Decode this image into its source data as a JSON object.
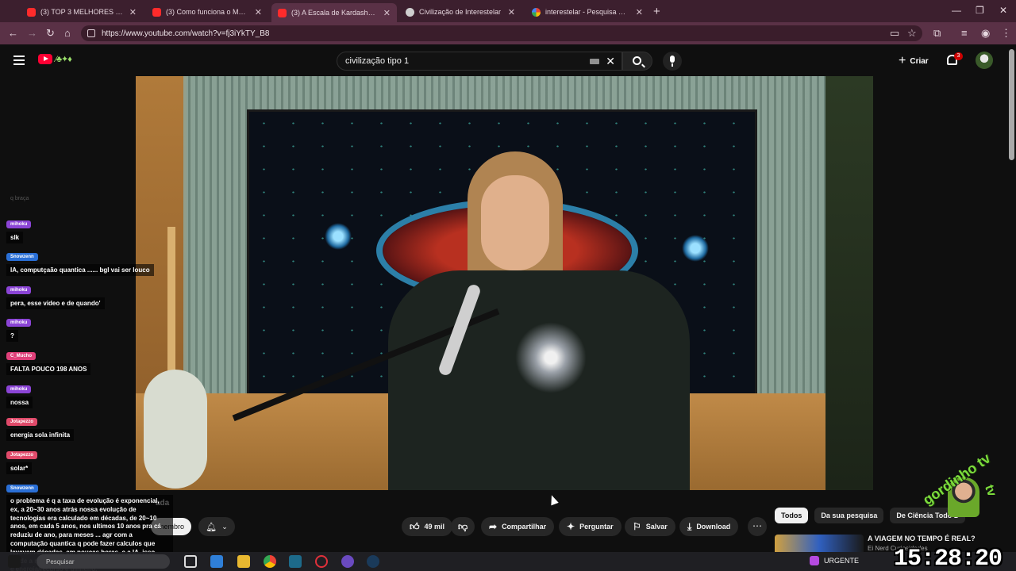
{
  "browser": {
    "tabs": [
      {
        "title": "(3) TOP 3 MELHORES MOUSES",
        "favicon": "youtube",
        "active": false
      },
      {
        "title": "(3) Como funciona o MAIOR TE",
        "favicon": "youtube",
        "active": false
      },
      {
        "title": "(3) A Escala de Kardashev Expli",
        "favicon": "youtube",
        "active": true
      },
      {
        "title": "Civilização de Interestelar",
        "favicon": "doc",
        "active": false
      },
      {
        "title": "interestelar - Pesquisa Google",
        "favicon": "google",
        "active": false
      }
    ],
    "new_tab": "+",
    "url": "https://www.youtube.com/watch?v=fj3iYkTY_B8"
  },
  "youtube": {
    "search_query": "civilização tipo 1",
    "create_label": "Criar",
    "notification_count": "3"
  },
  "chat": {
    "hint": "q braça",
    "messages": [
      {
        "user": "mihoku",
        "text": "slk",
        "color": "#8b44d6"
      },
      {
        "user": "Snowzenn",
        "text": "IA, computçaão quantica ...... bgl vai ser louco",
        "color": "#2a6fd6"
      },
      {
        "user": "mihoku",
        "text": "pera, esse video e de quando'",
        "color": "#8b44d6"
      },
      {
        "user": "mihoku",
        "text": "?",
        "color": "#8b44d6"
      },
      {
        "user": "C_Mucho",
        "text": "FALTA POUCO 198 ANOS",
        "color": "#e0407a"
      },
      {
        "user": "mihoku",
        "text": "nossa",
        "color": "#8b44d6"
      },
      {
        "user": "Jotapezzo",
        "text": "energia sola infinita",
        "color": "#e04a6a"
      },
      {
        "user": "Jotapezzo",
        "text": "solar*",
        "color": "#e04a6a"
      },
      {
        "user": "Snowzenn",
        "text": "o problema é q a taxa de evolução é exponencial, ex, a 20~30 anos atrás nossa evolução de tecnologias era calculado em décadas, de 20~10 anos, em cada 5 anos, nos ultimos 10 anos pra cá reduziu de ano, para meses ... agr com a computação quantica q pode fazer calculos que levavam décadas, em poucas horas, e a IA, isso tende a reduzir ainda mais, nossa limitação mesmo é energia/recurso e dinheiro.",
        "color": "#2a6fd6"
      }
    ]
  },
  "video": {
    "channel_fragment": "ada",
    "member_label": "membro",
    "likes": "49 mil",
    "share_label": "Compartilhar",
    "ask_label": "Perguntar",
    "save_label": "Salvar",
    "download_label": "Download"
  },
  "filters": [
    "Todos",
    "Da sua pesquisa",
    "De Ciência Todo D"
  ],
  "recommendation": {
    "title": "A VIAGEM NO TEMPO É REAL?",
    "channel": "Ei Nerd Curiosidades"
  },
  "taskbar": {
    "search_placeholder": "Pesquisar",
    "notification": "URGENTE"
  },
  "overlay": {
    "clock": "15:28:20",
    "brand": "gordinho tv",
    "brand_tv": "tv"
  },
  "colors": {
    "accent_red": "#ff0033",
    "tab_bg": "#3c1f2e",
    "toolbar_bg": "#5a3146",
    "brand_green": "#7cdc3c"
  }
}
